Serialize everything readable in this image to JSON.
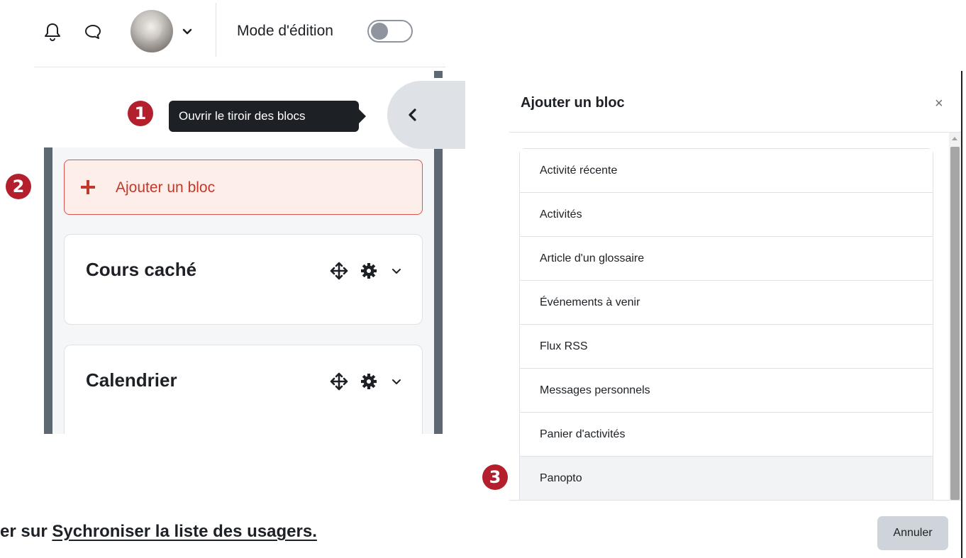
{
  "navbar": {
    "icons": {
      "notifications": "bell-icon",
      "messages": "chat-icon",
      "user_menu": "chevron-down-icon"
    },
    "edit_mode_label": "Mode d'édition",
    "edit_mode_on": false
  },
  "steps": {
    "one": "1",
    "two": "2",
    "three": "3"
  },
  "tooltip": {
    "text": "Ouvrir le tiroir des blocs"
  },
  "drawer": {
    "add_block_label": "Ajouter un bloc",
    "blocks": [
      {
        "title": "Cours caché"
      },
      {
        "title": "Calendrier"
      }
    ],
    "icons": {
      "move": "move-icon",
      "settings": "gear-icon",
      "menu": "chevron-down-icon",
      "toggle": "chevron-left-icon"
    }
  },
  "caption": {
    "prefix": "er sur ",
    "link": "Sychroniser la liste des usagers."
  },
  "modal": {
    "title": "Ajouter un bloc",
    "close": "×",
    "items": [
      "Activité récente",
      "Activités",
      "Article d'un glossaire",
      "Événements à venir",
      "Flux RSS",
      "Messages personnels",
      "Panier d'activités",
      "Panopto"
    ],
    "cancel_label": "Annuler"
  },
  "colors": {
    "badge": "#b41f2e",
    "accent_red": "#c0392b",
    "drawer_bar": "#5e6873",
    "tooltip_bg": "#1d2125"
  }
}
